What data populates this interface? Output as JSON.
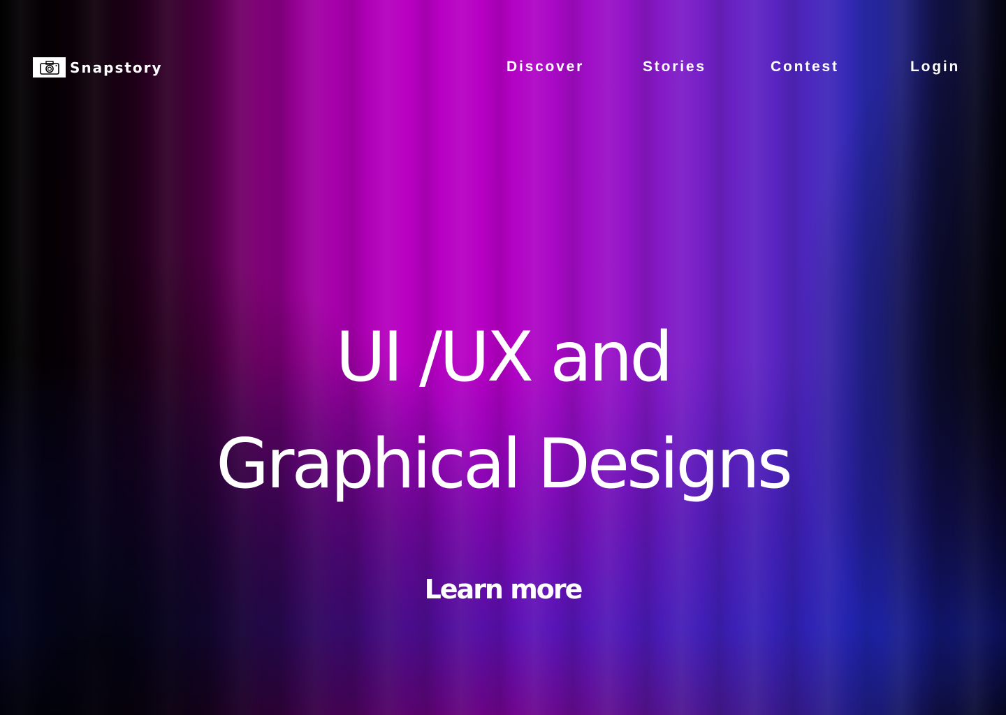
{
  "brand": {
    "name": "Snapstory",
    "icon": "camera-icon"
  },
  "nav": {
    "items": [
      {
        "label": "Discover"
      },
      {
        "label": "Stories"
      },
      {
        "label": "Contest"
      },
      {
        "label": "Login"
      }
    ]
  },
  "hero": {
    "line1": "UI /UX and",
    "line2": "Graphical Designs",
    "cta_label": "Learn more"
  },
  "colors": {
    "accent_magenta": "#b800c2",
    "accent_blue": "#2a2ab0",
    "text": "#ffffff",
    "background": "#000000"
  }
}
